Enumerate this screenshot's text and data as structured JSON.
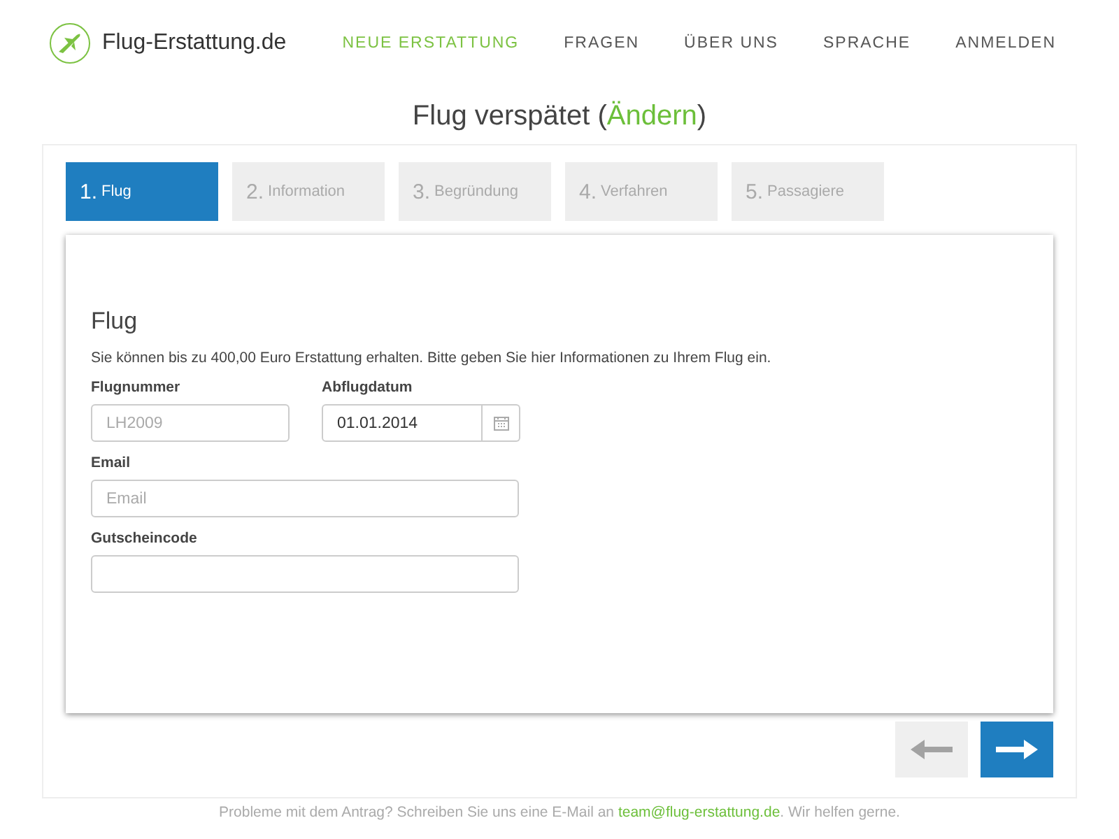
{
  "brand": {
    "name": "Flug-Erstattung.de"
  },
  "nav": [
    {
      "label": "NEUE ERSTATTUNG",
      "selected": true
    },
    {
      "label": "FRAGEN",
      "selected": false
    },
    {
      "label": "ÜBER UNS",
      "selected": false
    },
    {
      "label": "SPRACHE",
      "selected": false
    },
    {
      "label": "ANMELDEN",
      "selected": false
    }
  ],
  "page_title": {
    "text": "Flug verspätet",
    "open": "(",
    "link": "Ändern",
    "close": ")"
  },
  "steps": [
    {
      "number": "1.",
      "label": "Flug",
      "selected": true
    },
    {
      "number": "2.",
      "label": "Information",
      "selected": false
    },
    {
      "number": "3.",
      "label": "Begründung",
      "selected": false
    },
    {
      "number": "4.",
      "label": "Verfahren",
      "selected": false
    },
    {
      "number": "5.",
      "label": "Passagiere",
      "selected": false
    }
  ],
  "form": {
    "heading": "Flug",
    "intro": "Sie können bis zu 400,00 Euro Erstattung erhalten. Bitte geben Sie hier Informationen zu Ihrem Flug ein.",
    "rows": [
      [
        {
          "kind": "text",
          "label": "Flugnummer",
          "placeholder": "LH2009"
        },
        {
          "kind": "date",
          "label": "Abflugdatum",
          "value": "01.01.2014"
        }
      ],
      [
        {
          "kind": "wide",
          "label": "Email",
          "placeholder": "Email"
        }
      ],
      [
        {
          "kind": "wide",
          "label": "Gutscheincode"
        }
      ]
    ]
  },
  "nav_buttons": [
    {
      "kind": "back",
      "disabled": true
    },
    {
      "kind": "next",
      "disabled": false
    }
  ],
  "footer": {
    "before": "Probleme mit dem Antrag? Schreiben Sie uns eine E-Mail an",
    "link": "team@flug-erstattung.de",
    "after": ". Wir helfen gerne."
  }
}
